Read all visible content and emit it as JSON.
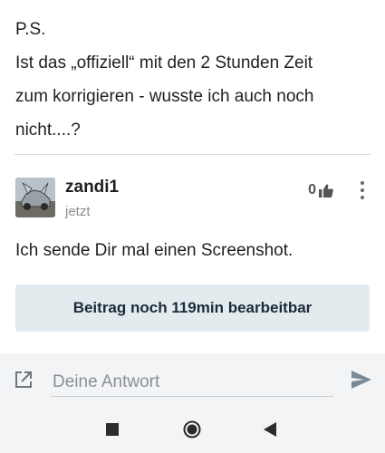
{
  "previous_post": {
    "lines": [
      "P.S.",
      "Ist das „offiziell“ mit den 2 Stunden Zeit",
      "zum korrigieren - wusste ich auch noch",
      "nicht....?"
    ]
  },
  "post": {
    "author": "zandi1",
    "time": "jetzt",
    "likes": "0",
    "body": "Ich sende Dir mal einen Screenshot.",
    "edit_label": "Beitrag noch 119min bearbeitbar"
  },
  "reply": {
    "placeholder": "Deine Antwort"
  },
  "icons": {
    "external": "external-link-icon",
    "send": "send-icon",
    "like": "thumbs-up-icon",
    "more": "more-vertical-icon"
  },
  "colors": {
    "edit_bar_bg": "#e4ebef",
    "edit_bar_text": "#1a2a38",
    "icon_gray": "#6a7680"
  }
}
